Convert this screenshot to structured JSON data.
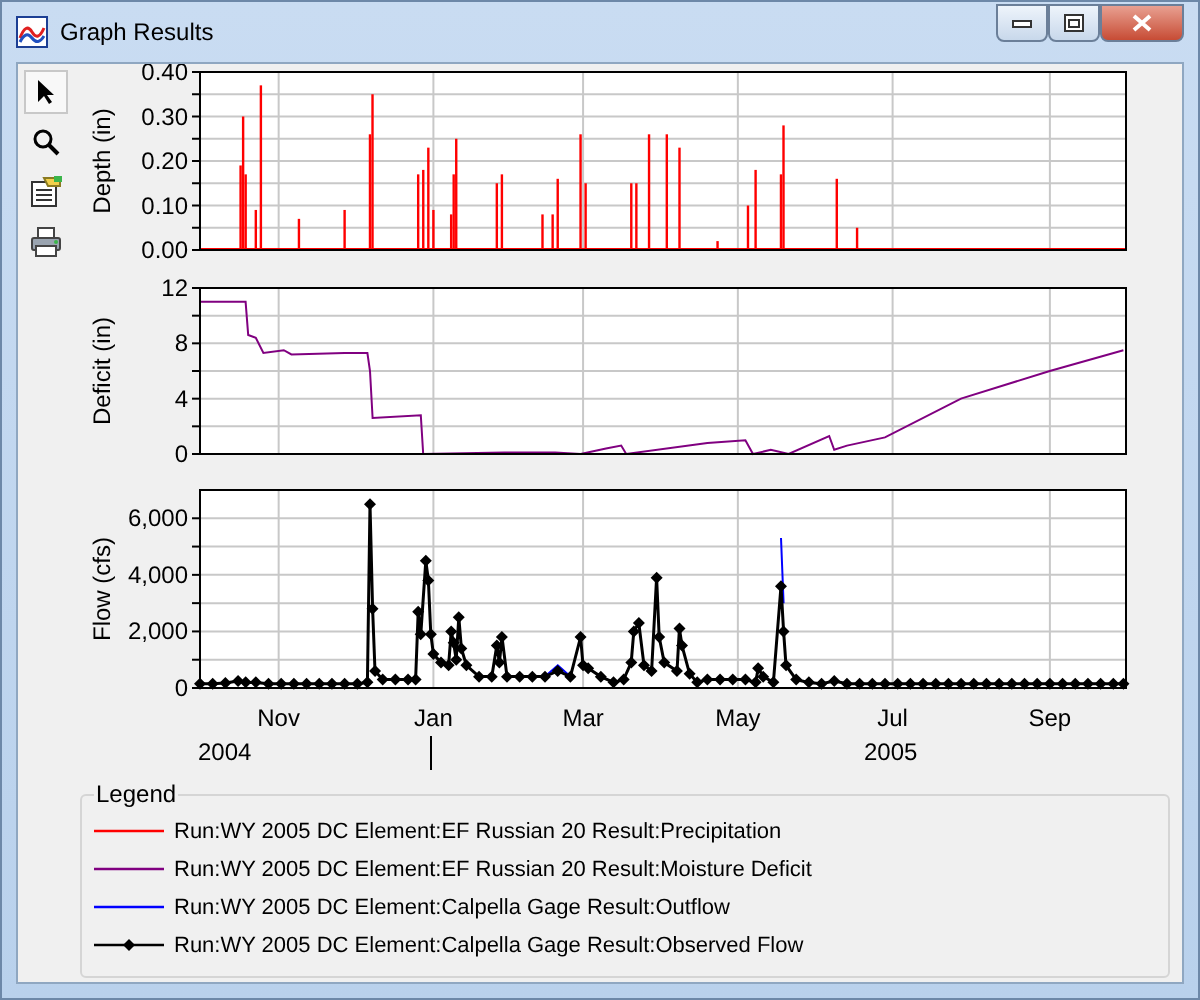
{
  "window": {
    "title": "Graph Results"
  },
  "tools": [
    {
      "selected": true
    },
    {
      "selected": false
    },
    {
      "selected": false
    },
    {
      "selected": false
    }
  ],
  "plots": [
    {
      "chart_data": {
        "type": "bar",
        "ylabel": "Depth (in)",
        "grid": true,
        "xlim": [
          "2004-10-01",
          "2005-10-01"
        ],
        "ylim": [
          0,
          0.4
        ],
        "yticks": [
          {
            "value": 0,
            "label": "0.00"
          },
          {
            "value": 0.1,
            "label": "0.10"
          },
          {
            "value": 0.2,
            "label": "0.20"
          },
          {
            "value": 0.3,
            "label": "0.30"
          },
          {
            "value": 0.4,
            "label": "0.40"
          }
        ],
        "x": [
          "2004-10-17",
          "2004-10-18",
          "2004-10-19",
          "2004-10-23",
          "2004-10-25",
          "2004-11-09",
          "2004-11-27",
          "2004-12-07",
          "2004-12-08",
          "2004-12-26",
          "2004-12-28",
          "2004-12-30",
          "2005-01-01",
          "2005-01-08",
          "2005-01-09",
          "2005-01-10",
          "2005-01-26",
          "2005-01-28",
          "2005-02-13",
          "2005-02-17",
          "2005-02-19",
          "2005-02-28",
          "2005-03-02",
          "2005-03-20",
          "2005-03-22",
          "2005-03-27",
          "2005-04-03",
          "2005-04-08",
          "2005-04-23",
          "2005-05-05",
          "2005-05-08",
          "2005-05-18",
          "2005-05-19",
          "2005-06-09",
          "2005-06-17"
        ],
        "series": [
          {
            "color": "#ff0000",
            "values": [
              0.19,
              0.3,
              0.17,
              0.09,
              0.37,
              0.07,
              0.09,
              0.26,
              0.35,
              0.17,
              0.18,
              0.23,
              0.09,
              0.08,
              0.17,
              0.25,
              0.15,
              0.17,
              0.08,
              0.08,
              0.16,
              0.26,
              0.15,
              0.15,
              0.15,
              0.26,
              0.26,
              0.23,
              0.02,
              0.1,
              0.18,
              0.17,
              0.28,
              0.16,
              0.05
            ]
          }
        ]
      }
    },
    {
      "chart_data": {
        "type": "line",
        "ylabel": "Deficit (in)",
        "grid": true,
        "xlim": [
          "2004-10-01",
          "2005-10-01"
        ],
        "ylim": [
          0,
          12
        ],
        "yticks": [
          {
            "value": 0,
            "label": "0"
          },
          {
            "value": 4,
            "label": "4"
          },
          {
            "value": 8,
            "label": "8"
          },
          {
            "value": 12,
            "label": "12"
          }
        ],
        "x": [
          "2004-10-01",
          "2004-10-19",
          "2004-10-20",
          "2004-10-23",
          "2004-10-26",
          "2004-11-03",
          "2004-11-06",
          "2004-11-27",
          "2004-12-06",
          "2004-12-07",
          "2004-12-08",
          "2004-12-27",
          "2004-12-28",
          "2005-01-29",
          "2005-02-18",
          "2005-02-28",
          "2005-03-10",
          "2005-03-16",
          "2005-03-18",
          "2005-04-19",
          "2005-05-04",
          "2005-05-07",
          "2005-05-14",
          "2005-05-21",
          "2005-06-06",
          "2005-06-08",
          "2005-06-13",
          "2005-06-28",
          "2005-07-28",
          "2005-09-01",
          "2005-09-30"
        ],
        "series": [
          {
            "color": "#800080",
            "values": [
              11,
              11,
              8.6,
              8.4,
              7.3,
              7.5,
              7.2,
              7.3,
              7.3,
              6,
              2.6,
              2.8,
              0,
              0.1,
              0.1,
              0,
              0.4,
              0.6,
              0,
              0.8,
              1.0,
              0,
              0.3,
              0,
              1.3,
              0.3,
              0.6,
              1.2,
              4,
              6,
              7.5
            ]
          }
        ]
      }
    },
    {
      "chart_data": {
        "type": "line",
        "ylabel": "Flow (cfs)",
        "grid": true,
        "xlim": [
          "2004-10-01",
          "2005-10-01"
        ],
        "ylim": [
          0,
          7000
        ],
        "xticks": [
          {
            "value": "2004-11-01",
            "label": "Nov"
          },
          {
            "value": "2005-01-01",
            "label": "Jan"
          },
          {
            "value": "2005-03-01",
            "label": "Mar"
          },
          {
            "value": "2005-05-01",
            "label": "May"
          },
          {
            "value": "2005-07-01",
            "label": "Jul"
          },
          {
            "value": "2005-09-01",
            "label": "Sep"
          }
        ],
        "yticks": [
          {
            "value": 0,
            "label": "0"
          },
          {
            "value": 2000,
            "label": "2,000"
          },
          {
            "value": 4000,
            "label": "4,000"
          },
          {
            "value": 6000,
            "label": "6,000"
          }
        ],
        "x": [
          "2004-10-01",
          "2004-10-06",
          "2004-10-11",
          "2004-10-16",
          "2004-10-19",
          "2004-10-23",
          "2004-10-28",
          "2004-11-02",
          "2004-11-07",
          "2004-11-12",
          "2004-11-17",
          "2004-11-22",
          "2004-11-27",
          "2004-12-02",
          "2004-12-06",
          "2004-12-07",
          "2004-12-08",
          "2004-12-09",
          "2004-12-12",
          "2004-12-17",
          "2004-12-22",
          "2004-12-25",
          "2004-12-26",
          "2004-12-27",
          "2004-12-29",
          "2004-12-30",
          "2004-12-31",
          "2005-01-01",
          "2005-01-04",
          "2005-01-07",
          "2005-01-08",
          "2005-01-09",
          "2005-01-10",
          "2005-01-11",
          "2005-01-12",
          "2005-01-14",
          "2005-01-19",
          "2005-01-24",
          "2005-01-26",
          "2005-01-27",
          "2005-01-28",
          "2005-01-30",
          "2005-02-04",
          "2005-02-09",
          "2005-02-14",
          "2005-02-19",
          "2005-02-24",
          "2005-02-28",
          "2005-03-01",
          "2005-03-03",
          "2005-03-08",
          "2005-03-13",
          "2005-03-17",
          "2005-03-20",
          "2005-03-21",
          "2005-03-23",
          "2005-03-25",
          "2005-03-28",
          "2005-03-30",
          "2005-03-31",
          "2005-04-02",
          "2005-04-07",
          "2005-04-08",
          "2005-04-09",
          "2005-04-12",
          "2005-04-15",
          "2005-04-19",
          "2005-04-24",
          "2005-04-29",
          "2005-05-04",
          "2005-05-08",
          "2005-05-09",
          "2005-05-11",
          "2005-05-15",
          "2005-05-18",
          "2005-05-19",
          "2005-05-20",
          "2005-05-24",
          "2005-05-29",
          "2005-06-03",
          "2005-06-08",
          "2005-06-13",
          "2005-06-18",
          "2005-06-23",
          "2005-06-28",
          "2005-07-03",
          "2005-07-08",
          "2005-07-13",
          "2005-07-18",
          "2005-07-23",
          "2005-07-28",
          "2005-08-02",
          "2005-08-07",
          "2005-08-12",
          "2005-08-17",
          "2005-08-22",
          "2005-08-27",
          "2005-09-01",
          "2005-09-06",
          "2005-09-11",
          "2005-09-16",
          "2005-09-21",
          "2005-09-26",
          "2005-09-30"
        ],
        "series": [
          {
            "color": "#0000ff",
            "values": [
              null,
              null,
              null,
              null,
              null,
              null,
              null,
              null,
              null,
              null,
              null,
              null,
              null,
              null,
              null,
              null,
              null,
              null,
              null,
              null,
              null,
              null,
              null,
              null,
              null,
              null,
              null,
              null,
              null,
              null,
              null,
              null,
              null,
              null,
              null,
              null,
              null,
              null,
              null,
              null,
              null,
              null,
              null,
              null,
              400,
              800,
              400,
              null,
              null,
              null,
              null,
              null,
              null,
              null,
              null,
              null,
              null,
              null,
              null,
              null,
              null,
              null,
              null,
              null,
              null,
              null,
              null,
              null,
              null,
              null,
              null,
              null,
              null,
              null,
              5300,
              3000,
              null,
              null,
              null,
              null,
              null,
              null,
              null,
              null,
              null,
              null,
              null,
              null,
              null,
              null,
              null,
              null,
              null,
              null,
              null,
              null,
              null,
              null,
              null,
              null,
              null,
              null,
              null,
              null
            ]
          },
          {
            "color": "#000000",
            "marker": "diamond",
            "values": [
              150,
              150,
              180,
              250,
              200,
              200,
              150,
              150,
              150,
              150,
              150,
              150,
              150,
              150,
              200,
              6500,
              2800,
              600,
              300,
              300,
              300,
              300,
              2700,
              1900,
              4500,
              3800,
              1900,
              1200,
              900,
              800,
              2000,
              1600,
              1000,
              2500,
              1400,
              800,
              400,
              400,
              1500,
              900,
              1800,
              400,
              400,
              400,
              400,
              600,
              400,
              1800,
              800,
              700,
              400,
              200,
              300,
              900,
              2000,
              2300,
              800,
              600,
              3900,
              1800,
              900,
              600,
              2100,
              1500,
              500,
              200,
              300,
              300,
              300,
              300,
              200,
              700,
              400,
              200,
              3600,
              2000,
              800,
              300,
              200,
              150,
              250,
              150,
              150,
              150,
              150,
              150,
              150,
              150,
              150,
              150,
              150,
              150,
              150,
              150,
              150,
              150,
              150,
              150,
              150,
              150,
              150,
              150,
              150,
              150
            ]
          }
        ]
      }
    }
  ],
  "years": [
    "2004",
    "2005"
  ],
  "legend": {
    "title": "Legend",
    "items": [
      {
        "label": "Run:WY 2005 DC Element:EF Russian 20 Result:Precipitation",
        "color": "#ff0000",
        "kind": "line"
      },
      {
        "label": "Run:WY 2005 DC Element:EF Russian 20 Result:Moisture Deficit",
        "color": "#800080",
        "kind": "line"
      },
      {
        "label": "Run:WY 2005 DC Element:Calpella Gage Result:Outflow",
        "color": "#0000ff",
        "kind": "line"
      },
      {
        "label": "Run:WY 2005 DC Element:Calpella Gage Result:Observed Flow",
        "color": "#000000",
        "kind": "marker"
      }
    ]
  }
}
